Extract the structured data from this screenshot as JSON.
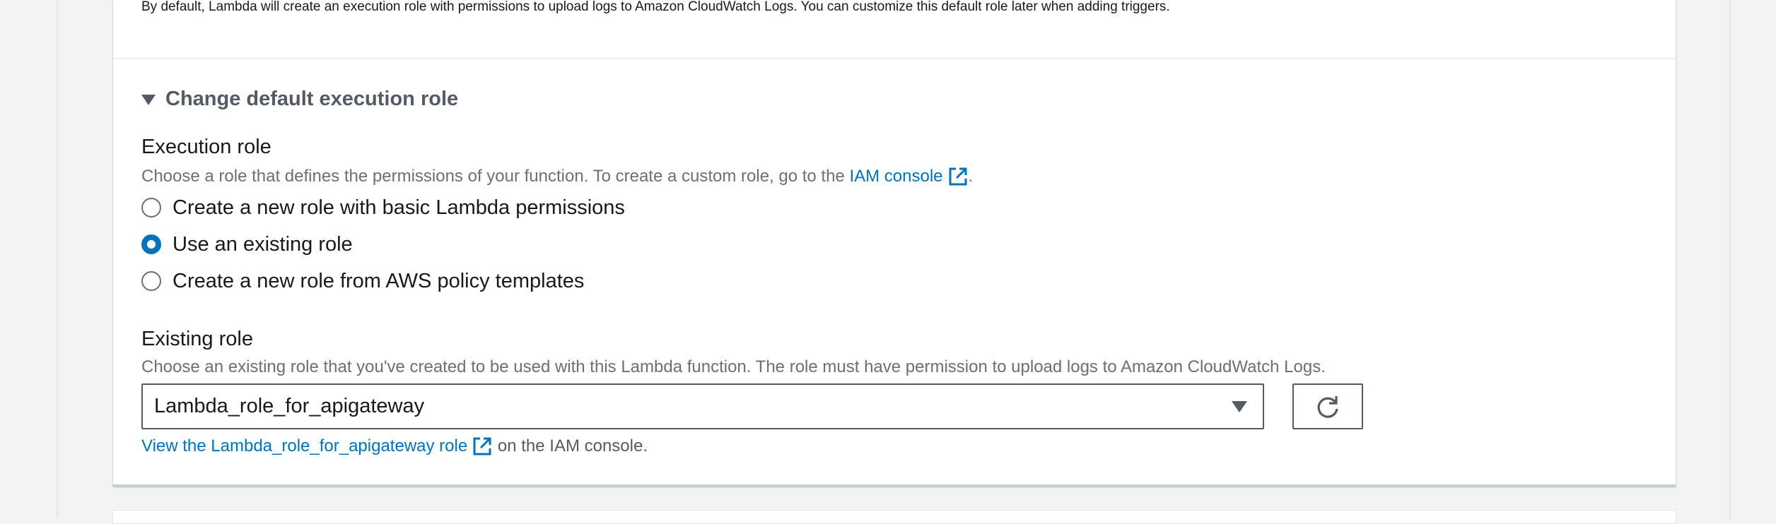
{
  "top_note": "By default, Lambda will create an execution role with permissions to upload logs to Amazon CloudWatch Logs. You can customize this default role later when adding triggers.",
  "expander": {
    "label": "Change default execution role",
    "icon": "caret-down-icon"
  },
  "execution_role": {
    "label": "Execution role",
    "description_prefix": "Choose a role that defines the permissions of your function. To create a custom role, go to the",
    "link_text": "IAM console",
    "description_suffix": ".",
    "options": [
      {
        "label": "Create a new role with basic Lambda permissions",
        "checked": false
      },
      {
        "label": "Use an existing role",
        "checked": true
      },
      {
        "label": "Create a new role from AWS policy templates",
        "checked": false
      }
    ]
  },
  "existing_role": {
    "label": "Existing role",
    "description": "Choose an existing role that you've created to be used with this Lambda function. The role must have permission to upload logs to Amazon CloudWatch Logs.",
    "selected_value": "Lambda_role_for_apigateway",
    "refresh_icon": "refresh-icon",
    "view_link_text": "View the Lambda_role_for_apigateway role",
    "view_suffix": "on the IAM console."
  },
  "colors": {
    "link": "#0073bb",
    "radio_checked": "#0073bb",
    "muted_text": "#687078"
  }
}
